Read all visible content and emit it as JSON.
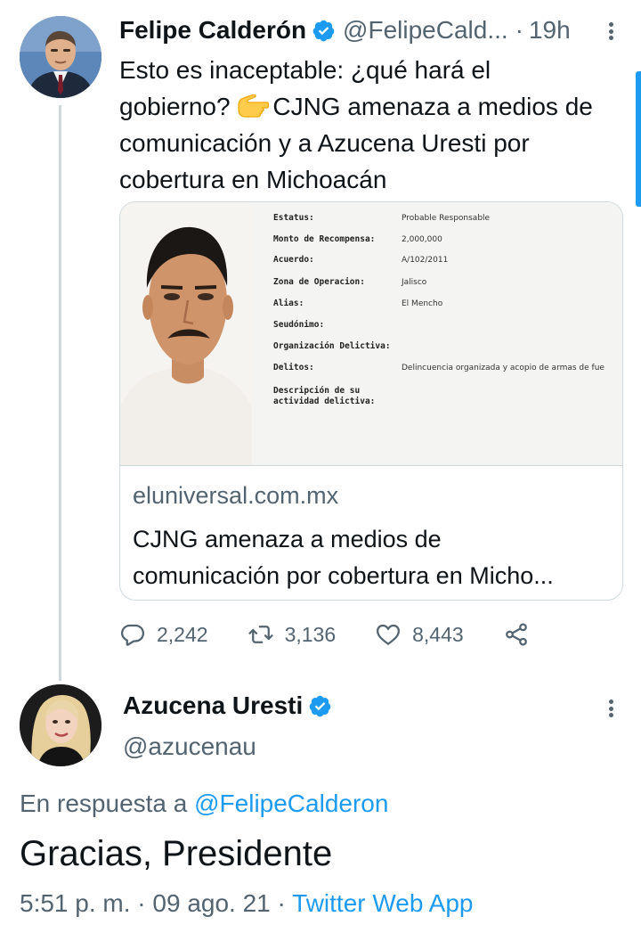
{
  "parent_tweet": {
    "author_name": "Felipe Calderón",
    "handle": "@FelipeCald...",
    "separator": "·",
    "time": "19h",
    "text_lines": [
      "Esto es inaceptable: ¿qué hará el",
      "gobierno?",
      "CJNG amenaza a medios de",
      "comunicación y a Azucena Uresti por",
      "cobertura en Michoacán"
    ],
    "emoji": "backhand-index-pointing-left",
    "link_card": {
      "image_fields": [
        {
          "label": "Estatus:",
          "value": "Probable Responsable"
        },
        {
          "label": "Monto de Recompensa:",
          "value": "2,000,000"
        },
        {
          "label": "Acuerdo:",
          "value": "A/102/2011"
        },
        {
          "label": "Zona de Operacion:",
          "value": "Jalisco"
        },
        {
          "label": "Alias:",
          "value": "El Mencho"
        },
        {
          "label": "Seudónimo:",
          "value": ""
        },
        {
          "label": "Organización Delictiva:",
          "value": ""
        },
        {
          "label": "Delitos:",
          "value": "Delincuencia organizada y acopio de armas de fue"
        },
        {
          "label": "Descripción de su",
          "value": ""
        },
        {
          "label": "actividad delictiva:",
          "value": ""
        }
      ],
      "domain": "eluniversal.com.mx",
      "title_lines": [
        "CJNG amenaza a medios de",
        "comunicación por cobertura en Micho..."
      ]
    },
    "actions": {
      "replies": "2,242",
      "retweets": "3,136",
      "likes": "8,443"
    }
  },
  "reply_tweet": {
    "author_name": "Azucena Uresti",
    "handle": "@azucenau",
    "reply_prefix": "En respuesta a",
    "reply_mention": "@FelipeCalderon",
    "text": "Gracias, Presidente",
    "time": "5:51 p. m.",
    "date": "09 ago. 21",
    "separator": "·",
    "source_app": "Twitter Web App"
  },
  "colors": {
    "accent": "#1d9bf0",
    "secondary_text": "#536471",
    "primary_text": "#0f1419",
    "border": "#cfd9de"
  }
}
